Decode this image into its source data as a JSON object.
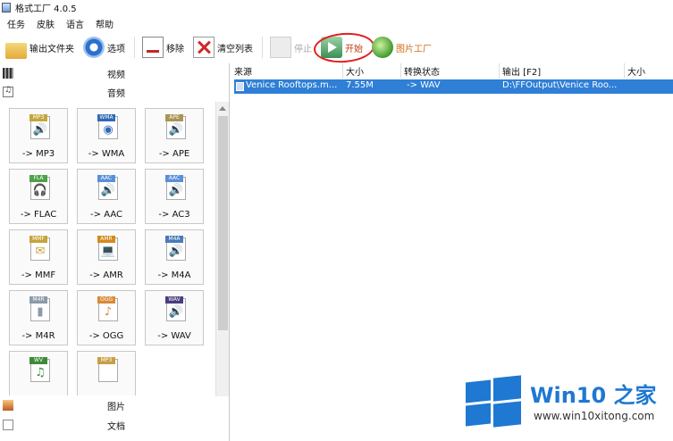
{
  "window": {
    "title": "格式工厂 4.0.5"
  },
  "menu": [
    "任务",
    "皮肤",
    "语言",
    "帮助"
  ],
  "toolbar": {
    "output_folder": "输出文件夹",
    "options": "选项",
    "remove": "移除",
    "clear_list": "清空列表",
    "stop": "停止",
    "start": "开始",
    "picture_factory": "图片工厂"
  },
  "categories": {
    "video": "视频",
    "audio": "音频",
    "picture": "图片",
    "document": "文档"
  },
  "audio_formats": [
    {
      "badge": "MP3",
      "label": "-> MP3",
      "color": "#c5a63c",
      "glyph": "🔊"
    },
    {
      "badge": "WMA",
      "label": "-> WMA",
      "color": "#2f6ab7",
      "glyph": "◉"
    },
    {
      "badge": "APE",
      "label": "-> APE",
      "color": "#a99455",
      "glyph": "🔊"
    },
    {
      "badge": "FLA",
      "label": "-> FLAC",
      "color": "#4fa04a",
      "glyph": "🎧"
    },
    {
      "badge": "AAC",
      "label": "-> AAC",
      "color": "#5a8fd9",
      "glyph": "🔊"
    },
    {
      "badge": "AAC",
      "label": "-> AC3",
      "color": "#5a8fd9",
      "glyph": "🔊"
    },
    {
      "badge": "MMF",
      "label": "-> MMF",
      "color": "#c6a43a",
      "glyph": "✉"
    },
    {
      "badge": "AMR",
      "label": "-> AMR",
      "color": "#d38a1d",
      "glyph": "💻"
    },
    {
      "badge": "M4A",
      "label": "-> M4A",
      "color": "#4a7bb8",
      "glyph": "🔊"
    },
    {
      "badge": "M4R",
      "label": "-> M4R",
      "color": "#8b9aa8",
      "glyph": "▮"
    },
    {
      "badge": "OGG",
      "label": "-> OGG",
      "color": "#d98a3a",
      "glyph": "♪"
    },
    {
      "badge": "WAV",
      "label": "-> WAV",
      "color": "#4b3c7e",
      "glyph": "🔊"
    },
    {
      "badge": "WV",
      "label": "",
      "color": "#3e8a3a",
      "glyph": "♫"
    },
    {
      "badge": "MP3",
      "label": "",
      "color": "#c89f45",
      "glyph": ""
    }
  ],
  "file_list": {
    "columns": [
      "来源",
      "大小",
      "转换状态",
      "输出 [F2]",
      "大小"
    ],
    "rows": [
      {
        "source": "Venice Rooftops.m...",
        "size": "7.55M",
        "status": "-> WAV",
        "output": "D:\\FFOutput\\Venice Roo..."
      }
    ]
  },
  "watermark": {
    "title": "Win10 之家",
    "url": "www.win10xitong.com"
  }
}
